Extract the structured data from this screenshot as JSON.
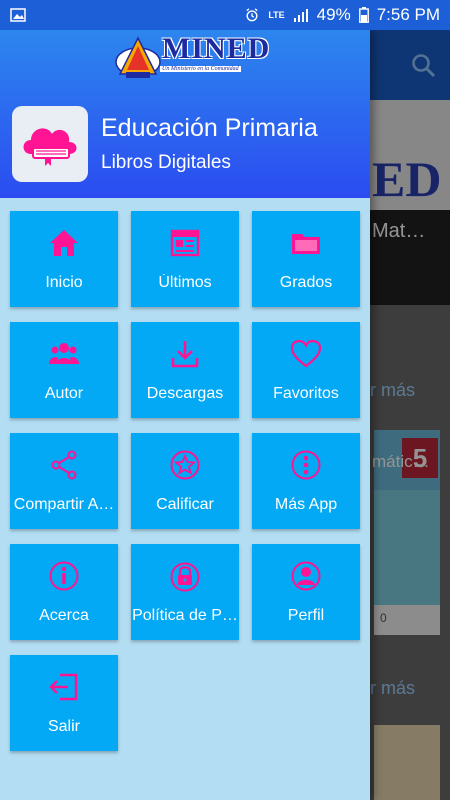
{
  "status_bar": {
    "network": "LTE",
    "battery": "49%",
    "time": "7:56 PM"
  },
  "background_app": {
    "banner_partial": "ED",
    "banner_text_partial": "Mat…",
    "link_1": "r más",
    "link_2": "r más",
    "book_partial_title": "mátic…",
    "book_counter": "0",
    "book_number": "5"
  },
  "drawer": {
    "logo": {
      "title": "MINED",
      "subtitle": "Un Ministerio en la Comunidad"
    },
    "app_title": "Educación Primaria",
    "app_subtitle": "Libros Digitales",
    "menu": [
      {
        "label": "Inicio",
        "icon": "home-icon"
      },
      {
        "label": "Últimos",
        "icon": "newspaper-icon"
      },
      {
        "label": "Grados",
        "icon": "folder-icon"
      },
      {
        "label": "Autor",
        "icon": "group-icon"
      },
      {
        "label": "Descargas",
        "icon": "download-icon"
      },
      {
        "label": "Favoritos",
        "icon": "heart-icon"
      },
      {
        "label": "Compartir A…",
        "icon": "share-icon"
      },
      {
        "label": "Calificar",
        "icon": "star-icon"
      },
      {
        "label": "Más App",
        "icon": "more-icon"
      },
      {
        "label": "Acerca",
        "icon": "info-icon"
      },
      {
        "label": "Política de P…",
        "icon": "lock-icon"
      },
      {
        "label": "Perfil",
        "icon": "profile-icon"
      },
      {
        "label": "Salir",
        "icon": "logout-icon"
      }
    ]
  },
  "colors": {
    "tile": "#03a9f4",
    "icon_accent": "#ff1493",
    "drawer_bg": "#b3ddf2",
    "header_top": "#2d86ee",
    "header_bottom": "#2b4cf0"
  }
}
